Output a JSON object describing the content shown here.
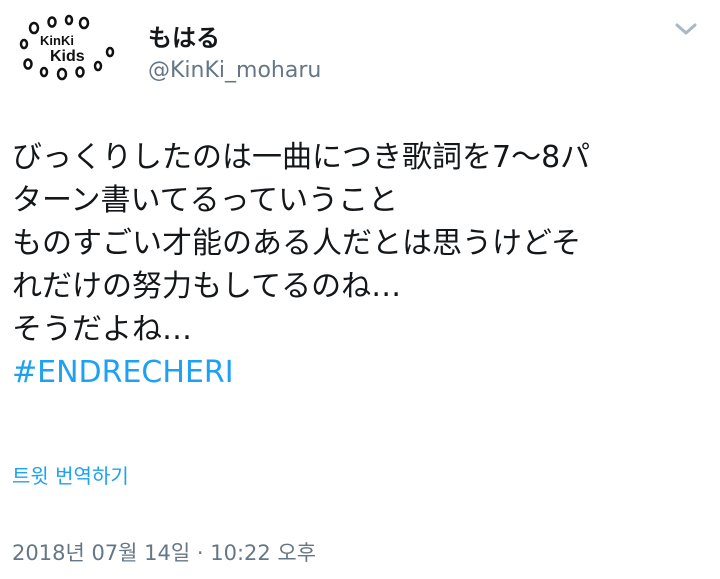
{
  "header": {
    "avatar_logo": "KinKi Kids",
    "display_name": "もはる",
    "handle": "@KinKi_moharu",
    "menu_icon": "chevron-down-icon"
  },
  "tweet": {
    "lines": [
      "びっくりしたのは一曲につき歌詞を7〜8パ",
      "ターン書いてるっていうこと",
      "ものすごい才能のある人だとは思うけどそ",
      "れだけの努力もしてるのね…",
      "そうだよね…"
    ],
    "hashtag": "#ENDRECHERI",
    "translate_label": "트윗 번역하기",
    "timestamp": "2018년 07월 14일 · 10:22 오후"
  },
  "colors": {
    "link": "#1da1f2",
    "text": "#14171a",
    "secondary": "#657786",
    "chevron": "#aab8c2"
  }
}
